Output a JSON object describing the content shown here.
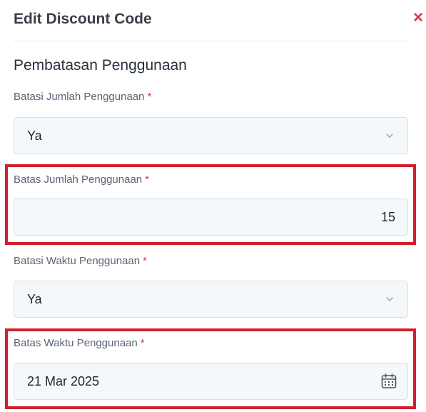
{
  "header": {
    "title": "Edit Discount Code",
    "close_glyph": "×"
  },
  "section": {
    "title": "Pembatasan Penggunaan"
  },
  "fields": {
    "limit_usage_count": {
      "label": "Batasi Jumlah Penggunaan",
      "required_mark": "*",
      "value": "Ya"
    },
    "usage_count": {
      "label": "Batas Jumlah Penggunaan",
      "required_mark": "*",
      "value": "15"
    },
    "limit_usage_time": {
      "label": "Batasi Waktu Penggunaan",
      "required_mark": "*",
      "value": "Ya"
    },
    "usage_time": {
      "label": "Batas Waktu Penggunaan",
      "required_mark": "*",
      "value": "21 Mar 2025"
    }
  },
  "colors": {
    "close": "#e0324b",
    "required": "#e0324b",
    "highlight": "#d0202e",
    "field_bg": "#f5f8fb"
  },
  "icons": {
    "close": "close-icon",
    "select": "chevron-down-icon",
    "date": "calendar-icon"
  }
}
